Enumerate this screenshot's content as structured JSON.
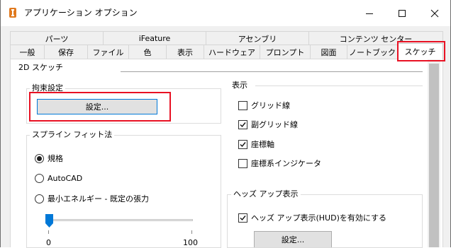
{
  "window": {
    "title": "アプリケーション オプション"
  },
  "tabs": {
    "row_back": [
      "パーツ",
      "iFeature",
      "アセンブリ",
      "コンテンツ センター"
    ],
    "row_front": [
      "一般",
      "保存",
      "ファイル",
      "色",
      "表示",
      "ハードウェア",
      "プロンプト",
      "図面",
      "ノートブック",
      "スケッチ"
    ],
    "active": "スケッチ"
  },
  "section": {
    "title_2d": "2D スケッチ"
  },
  "constraint_group": {
    "legend": "拘束設定",
    "settings_button": "設定..."
  },
  "spline_group": {
    "legend": "スプライン フィット法",
    "options": [
      "規格",
      "AutoCAD",
      "最小エネルギー - 既定の張力"
    ],
    "selected": "規格",
    "slider": {
      "value": 0,
      "min_label": "0",
      "max_label": "100"
    }
  },
  "display_group": {
    "legend": "表示",
    "items": [
      {
        "label": "グリッド線",
        "checked": false
      },
      {
        "label": "副グリッド線",
        "checked": true
      },
      {
        "label": "座標軸",
        "checked": true
      },
      {
        "label": "座標系インジケータ",
        "checked": false
      }
    ]
  },
  "hud_group": {
    "legend": "ヘッズ アップ表示",
    "enable_label": "ヘッズ アップ表示(HUD)を有効にする",
    "enable_checked": true,
    "settings_button": "設定..."
  },
  "colors": {
    "highlight": "#e81123",
    "accent": "#0078d7",
    "dialog_bg": "#f0f0f0"
  }
}
